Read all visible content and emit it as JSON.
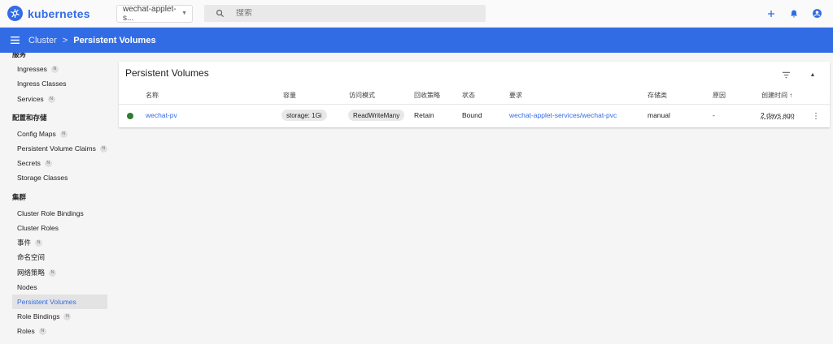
{
  "topbar": {
    "brand": "kubernetes",
    "namespace": "wechat-applet-s...",
    "search_placeholder": "搜索"
  },
  "header": {
    "crumbs": [
      "Cluster",
      "Persistent Volumes"
    ]
  },
  "sidebar": {
    "cut_top": "服务",
    "items_a": [
      {
        "label": "Ingresses",
        "badge": "N"
      },
      {
        "label": "Ingress Classes",
        "badge": ""
      },
      {
        "label": "Services",
        "badge": "N"
      }
    ],
    "section_config": "配置和存储",
    "items_b": [
      {
        "label": "Config Maps",
        "badge": "N"
      },
      {
        "label": "Persistent Volume Claims",
        "badge": "N"
      },
      {
        "label": "Secrets",
        "badge": "N"
      },
      {
        "label": "Storage Classes",
        "badge": ""
      }
    ],
    "section_cluster": "集群",
    "items_c": [
      {
        "label": "Cluster Role Bindings",
        "badge": ""
      },
      {
        "label": "Cluster Roles",
        "badge": ""
      },
      {
        "label": "事件",
        "badge": "N"
      },
      {
        "label": "命名空间",
        "badge": ""
      },
      {
        "label": "网络策略",
        "badge": "N"
      },
      {
        "label": "Nodes",
        "badge": ""
      },
      {
        "label": "Persistent Volumes",
        "badge": ""
      },
      {
        "label": "Role Bindings",
        "badge": "N"
      },
      {
        "label": "Roles",
        "badge": "N"
      }
    ]
  },
  "card": {
    "title": "Persistent Volumes",
    "columns": {
      "name": "名称",
      "capacity": "容量",
      "access_modes": "访问模式",
      "reclaim_policy": "回收策略",
      "status": "状态",
      "claim": "要求",
      "storage_class": "存储类",
      "reason": "原因",
      "created": "创建时间"
    },
    "rows": [
      {
        "name": "wechat-pv",
        "capacity": "storage: 1Gi",
        "access_modes": "ReadWriteMany",
        "reclaim_policy": "Retain",
        "status": "Bound",
        "claim": "wechat-applet-services/wechat-pvc",
        "storage_class": "manual",
        "reason": "-",
        "created": "2 days ago"
      }
    ]
  },
  "colors": {
    "primary": "#326ce5",
    "status_ok": "#2e7d32"
  },
  "icons": [
    "kubernetes-logo-icon",
    "chevron-down-icon",
    "search-icon",
    "add-icon",
    "bell-icon",
    "account-icon",
    "menu-icon",
    "filter-icon",
    "collapse-icon",
    "arrow-up-icon",
    "more-vert-icon"
  ]
}
